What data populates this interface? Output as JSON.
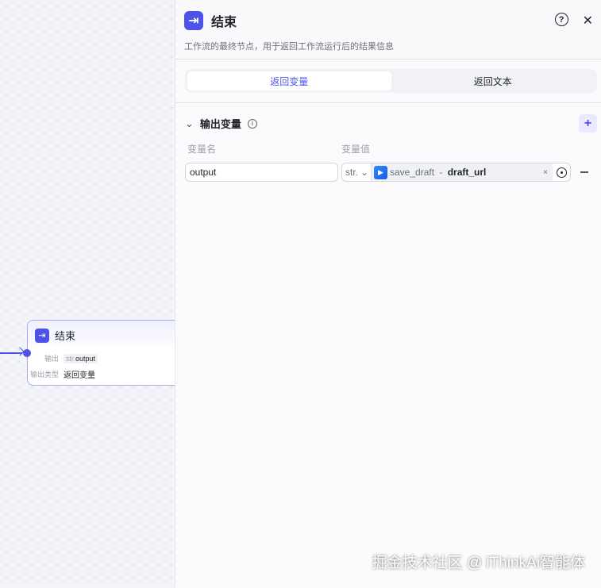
{
  "node": {
    "title": "结束",
    "output_label": "输出",
    "output_type_tag": "str.",
    "output_var": "output",
    "type_label": "输出类型",
    "type_value": "返回变量"
  },
  "panel": {
    "title": "结束",
    "description": "工作流的最终节点，用于返回工作流运行后的结果信息",
    "help": "?",
    "close": "✕",
    "tabs": [
      {
        "label": "返回变量",
        "active": true
      },
      {
        "label": "返回文本",
        "active": false
      }
    ],
    "section": {
      "title": "输出变量",
      "info": "i",
      "add": "+",
      "col_name": "变量名",
      "col_value": "变量值",
      "rows": [
        {
          "name": "output",
          "type": "str.",
          "ref_node": "save_draft",
          "sep": " - ",
          "ref_var": "draft_url",
          "clear": "×"
        }
      ]
    }
  },
  "watermark": "掘金技术社区 @ iThinkAi智能体"
}
